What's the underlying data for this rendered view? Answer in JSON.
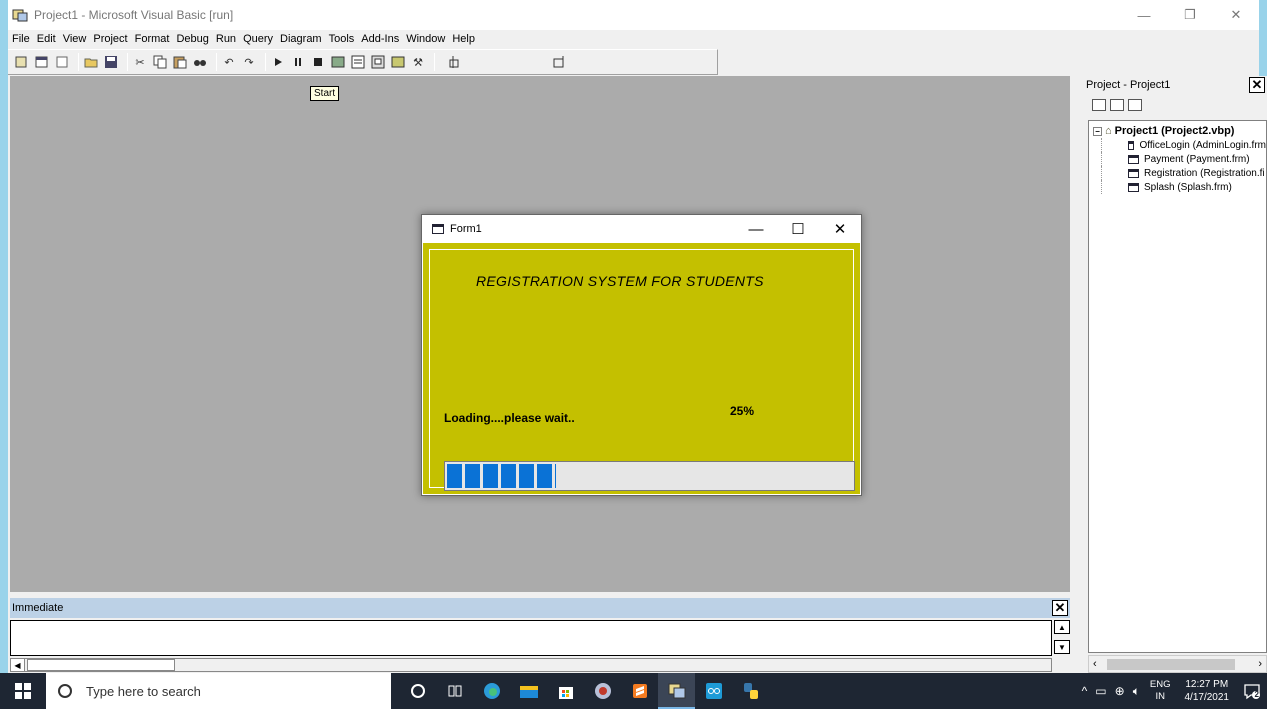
{
  "ide": {
    "title": "Project1 - Microsoft Visual Basic [run]",
    "window_controls": {
      "minimize": "—",
      "restore": "❐",
      "close": "✕"
    }
  },
  "menu": [
    {
      "label": "File"
    },
    {
      "label": "Edit"
    },
    {
      "label": "View"
    },
    {
      "label": "Project"
    },
    {
      "label": "Format"
    },
    {
      "label": "Debug"
    },
    {
      "label": "Run"
    },
    {
      "label": "Query"
    },
    {
      "label": "Diagram"
    },
    {
      "label": "Tools"
    },
    {
      "label": "Add-Ins"
    },
    {
      "label": "Window"
    },
    {
      "label": "Help"
    }
  ],
  "tooltip": {
    "text": "Start"
  },
  "project_explorer": {
    "title": "Project - Project1",
    "close": "✕",
    "root": "Project1 (Project2.vbp)",
    "items": [
      {
        "label": "OfficeLogin (AdminLogin.frm"
      },
      {
        "label": "Payment (Payment.frm)"
      },
      {
        "label": "Registration (Registration.fi"
      },
      {
        "label": "Splash (Splash.frm)"
      }
    ]
  },
  "immediate": {
    "title": "Immediate",
    "close": "✕"
  },
  "form1": {
    "title": "Form1",
    "controls": {
      "minimize": "—",
      "maximize": "☐",
      "close": "✕"
    },
    "headline": "REGISTRATION SYSTEM FOR STUDENTS",
    "loading_text": "Loading....please wait..",
    "percent_text": "25%",
    "progress": 0.27,
    "colors": {
      "background": "#c4c000",
      "progress": "#0a72d6"
    }
  },
  "taskbar": {
    "search_placeholder": "Type here to search",
    "lang_top": "ENG",
    "lang_bottom": "IN",
    "time": "12:27 PM",
    "date": "4/17/2021",
    "notification_count": "2"
  }
}
